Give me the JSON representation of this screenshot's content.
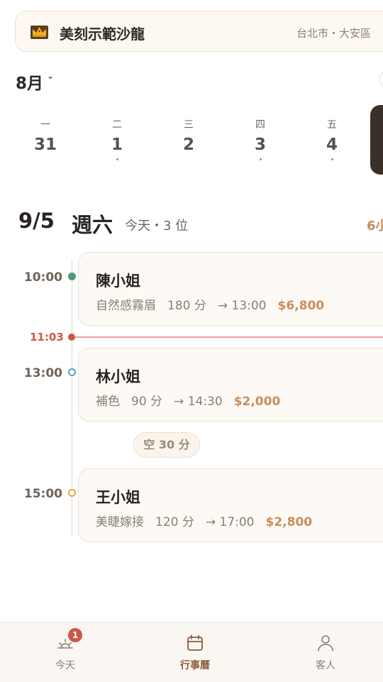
{
  "header": {
    "salon_name": "美刻示範沙龍",
    "location": "台北市・大安區",
    "crown_icon": "crown-icon"
  },
  "calendar": {
    "month": "8月",
    "week": [
      {
        "weekday": "一",
        "date": "31",
        "has_dot": false
      },
      {
        "weekday": "二",
        "date": "1",
        "has_dot": true
      },
      {
        "weekday": "三",
        "date": "2",
        "has_dot": false
      },
      {
        "weekday": "四",
        "date": "3",
        "has_dot": true
      },
      {
        "weekday": "五",
        "date": "4",
        "has_dot": true
      }
    ]
  },
  "day": {
    "date": "9/5",
    "weekday": "週六",
    "subtitle": "今天・3 位",
    "right_text": "6小"
  },
  "now": {
    "time": "11:03"
  },
  "appointments": [
    {
      "time": "10:00",
      "name": "陳小姐",
      "service": "自然感霧眉",
      "duration": "180 分",
      "end": "→ 13:00",
      "price": "$6,800",
      "status_color": "#4e9a7a",
      "filled": true
    },
    {
      "time": "13:00",
      "name": "林小姐",
      "service": "補色",
      "duration": "90 分",
      "end": "→ 14:30",
      "price": "$2,000",
      "status_color": "#5a9fc4",
      "filled": false
    },
    {
      "time": "15:00",
      "name": "王小姐",
      "service": "美睫嫁接",
      "duration": "120 分",
      "end": "→ 17:00",
      "price": "$2,800",
      "status_color": "#e0a93a",
      "filled": false
    }
  ],
  "gap": {
    "label": "空 30 分"
  },
  "nav": {
    "items": [
      {
        "label": "今天",
        "icon": "sunrise-icon",
        "badge": "1",
        "active": false
      },
      {
        "label": "行事曆",
        "icon": "calendar-icon",
        "active": true
      },
      {
        "label": "客人",
        "icon": "person-icon",
        "active": false
      }
    ]
  },
  "colors": {
    "accent": "#c98d5e",
    "now_red": "#d0554a",
    "card_bg": "#fdf9f4"
  }
}
